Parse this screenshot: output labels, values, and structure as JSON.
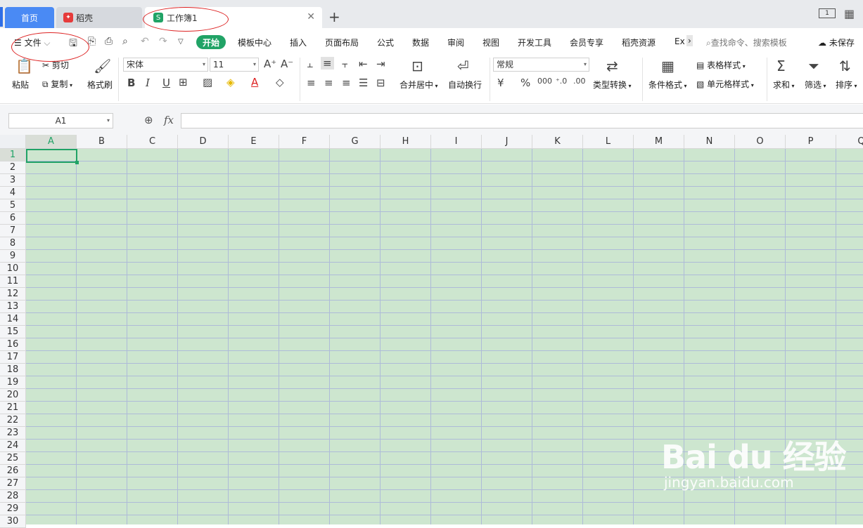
{
  "tabs": {
    "home": "首页",
    "docer": "稻壳",
    "workbook": "工作簿1"
  },
  "menu": {
    "file": "文件",
    "start": "开始",
    "items": [
      "模板中心",
      "插入",
      "页面布局",
      "公式",
      "数据",
      "审阅",
      "视图",
      "开发工具",
      "会员专享",
      "稻壳资源",
      "Ex"
    ],
    "search_placeholder": "查找命令、搜索模板",
    "unsaved": "未保存"
  },
  "ribbon": {
    "paste": "粘贴",
    "cut": "剪切",
    "copy": "复制",
    "format_painter": "格式刷",
    "font_name": "宋体",
    "font_size": "11",
    "merge_center": "合并居中",
    "wrap_text": "自动换行",
    "number_format": "常规",
    "type_convert": "类型转换",
    "conditional_format": "条件格式",
    "table_style": "表格样式",
    "cell_style": "单元格样式",
    "sum": "求和",
    "filter": "筛选",
    "sort": "排序"
  },
  "formula_bar": {
    "name_box": "A1",
    "fx": "fx",
    "formula": ""
  },
  "grid": {
    "columns": [
      "A",
      "B",
      "C",
      "D",
      "E",
      "F",
      "G",
      "H",
      "I",
      "J",
      "K",
      "L",
      "M",
      "N",
      "O",
      "P",
      "Q"
    ],
    "rows": [
      "1",
      "2",
      "3",
      "4",
      "5",
      "6",
      "7",
      "8",
      "9",
      "10",
      "11",
      "12",
      "13",
      "14",
      "15",
      "16",
      "17",
      "18",
      "19",
      "20",
      "21",
      "22",
      "23",
      "24",
      "25",
      "26",
      "27",
      "28",
      "29",
      "30"
    ],
    "selected_cell": "A1"
  },
  "watermark": {
    "logo": "Bai du 经验",
    "url": "jingyan.baidu.com"
  },
  "colors": {
    "accent": "#21a366",
    "tab_blue": "#4a8af4",
    "cell_bg": "#cde6cf",
    "annotation": "#dd2222"
  },
  "icons": [
    "hamburger-icon",
    "save-icon",
    "undo-icon",
    "redo-icon",
    "search-icon",
    "cloud-icon",
    "paste-icon",
    "scissors-icon",
    "copy-icon",
    "brush-icon",
    "bold-icon",
    "italic-icon",
    "underline-icon",
    "border-icon",
    "fill-icon",
    "font-color-icon",
    "eraser-icon",
    "sum-icon",
    "filter-icon",
    "sort-icon"
  ]
}
